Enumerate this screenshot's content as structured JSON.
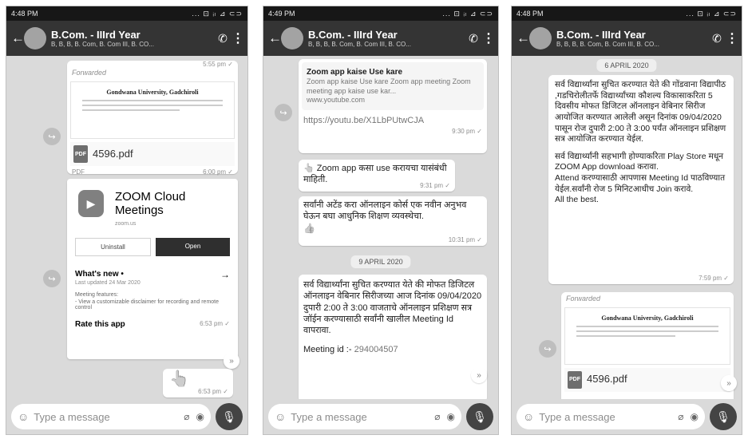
{
  "screens": [
    {
      "status_time": "4:48 PM",
      "status_icons": "... ⊡ ᵢₗ ⊿ ⊂⊃",
      "group_title": "B.Com. - IIIrd Year",
      "group_members": "B, B, B, B. Com, B. Com III, B. CO...",
      "messages": {
        "forwarded": "Forwarded",
        "time_partial": "5:55 pm ✓",
        "letter_heading": "Gondwana University, Gadchiroli",
        "pdf_name": "4596.pdf",
        "pdf_label": "PDF",
        "pdf_time": "6:00 pm ✓",
        "ps_title": "ZOOM Cloud Meetings",
        "ps_dev": "zoom.us",
        "ps_uninstall": "Uninstall",
        "ps_open": "Open",
        "ps_whatsnew": "What's new •",
        "ps_updated": "Last updated 24 Mar 2020",
        "ps_features": "Meeting features:",
        "ps_feature1": "- View a customizable disclaimer for recording and remote control",
        "ps_rate": "Rate this app",
        "ps_time": "6:53 pm ✓",
        "emoji_time": "6:53 pm ✓"
      },
      "placeholder": "Type a message"
    },
    {
      "status_time": "4:49 PM",
      "status_icons": "... ⊡ ᵢₗ ⊿ ⊂⊃",
      "group_title": "B.Com. - IIIrd Year",
      "group_members": "B, B, B, B. Com, B. Com III, B. CO...",
      "messages": {
        "link_title": "Zoom app kaise Use kare",
        "link_desc": "Zoom app kaise Use kare Zoom app meeting Zoom meeting app kaise use kar...",
        "link_domain": "www.youtube.com",
        "link_url": "https://youtu.be/X1LbPUtwCJA",
        "link_time": "9:30 pm ✓",
        "zoom_msg": "👆 Zoom app कसा use करायचा यासंबंधी माहिती.",
        "zoom_time": "9:31 pm ✓",
        "attend_msg": "सर्वांनी अटेंड करा ऑनलाइन कोर्स एक नवीन अनुभव घेऊन बघा  आधुनिक शिक्षण व्यवस्थेचा.",
        "attend_emoji": "👍",
        "attend_time": "10:31 pm ✓",
        "date_chip": "9 APRIL 2020",
        "notice_msg": "सर्व विद्यार्थ्यांना सुचित करण्यात येते की मोफत डिजिटल ऑनलाइन वेबिनार सिरीजच्या आज दिनांक 09/04/2020 दुपारी 2:00 ते 3:00 वाजताचे ऑनलाइन प्रशिक्षण सत्र जॉईन करण्यासाठी सर्वांनी खालील Meeting Id वापरावा.",
        "meeting_label": "Meeting id :-",
        "meeting_id": "294004507"
      },
      "placeholder": "Type a message"
    },
    {
      "status_time": "4:48 PM",
      "status_icons": "... ⊡ ᵢₗ ⊿ ⊂⊃",
      "group_title": "B.Com. - IIIrd Year",
      "group_members": "B, B, B, B. Com, B. Com III, B. CO...",
      "messages": {
        "date_chip": "6 APRIL 2020",
        "notice_p1": "सर्व विद्यार्थ्यांना सुचित करण्यात येते की गोंडवाना विद्यापीठ ,गडचिरोलीतर्फे विद्यार्थ्यांच्या कौशल्य विकासाकरिता 5 दिवसीय मोफत डिजिटल ऑनलाइन वेबिनार सिरीज आयोजित करण्यात आलेली असून दिनांक 09/04/2020 पासून रोज दुपारी 2:00 ते 3:00 पर्यंत ऑनलाइन प्रशिक्षण सत्र आयोजित करण्यात येईल.",
        "notice_p2": "सर्व विद्यार्थ्यांनी सहभागी होण्याकरिता Play Store मधून ZOOM App download करावा.",
        "notice_p3": "Attend  करण्यासाठी आपणास Meeting Id पाठविण्यात येईल.सर्वांनी रोज  5 मिनिटआधीच Join करावे.",
        "notice_p4": "All the best.",
        "notice_time": "7:59 pm ✓",
        "forwarded": "Forwarded",
        "letter_heading": "Gondwana University, Gadchiroli",
        "pdf_name": "4596.pdf"
      },
      "placeholder": "Type a message"
    }
  ]
}
